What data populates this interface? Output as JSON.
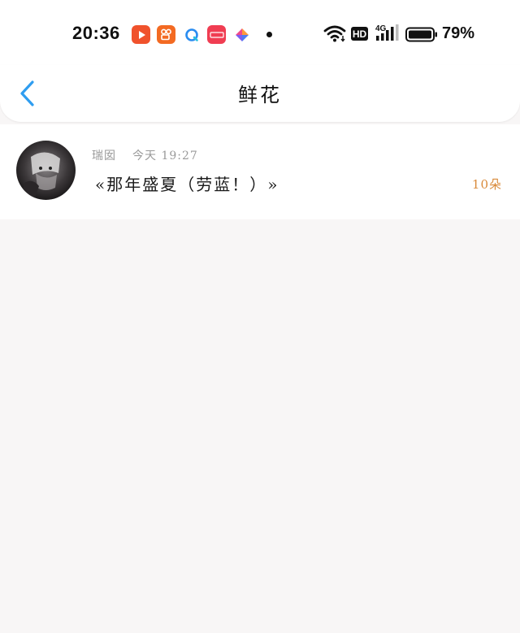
{
  "status_bar": {
    "time": "20:36",
    "network_badge": "HD",
    "network_type": "4G",
    "battery": "79%",
    "battery_level": 0.79,
    "app_icons": [
      {
        "name": "video-app-icon",
        "color": "#f0522c"
      },
      {
        "name": "kuaishou-icon",
        "color": "#f36a22"
      },
      {
        "name": "browser-icon",
        "color": "#2a8cf0"
      },
      {
        "name": "xiaohongshu-icon",
        "color": "#f03d52"
      },
      {
        "name": "pinwheel-app-icon",
        "color": "#6a6ff0"
      }
    ]
  },
  "header": {
    "title": "鲜花",
    "back_icon": "chevron-left-icon",
    "accent": "#2f9df0"
  },
  "list": {
    "items": [
      {
        "user": "瑞囡",
        "time": "今天 19:27",
        "content": "«那年盛夏（劳蓝！）»",
        "count": "10朵"
      }
    ]
  }
}
